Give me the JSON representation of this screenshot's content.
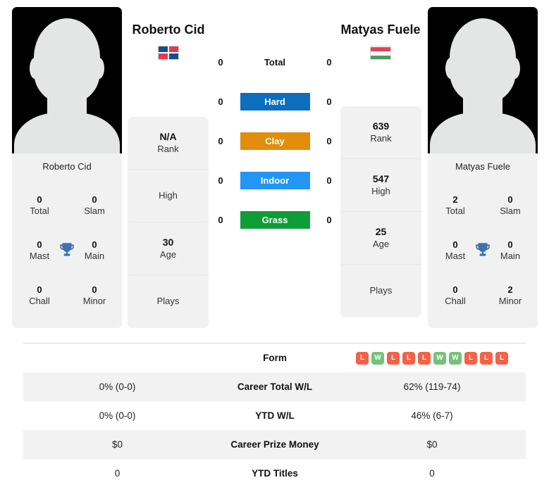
{
  "players": {
    "left": {
      "name": "Roberto Cid",
      "photo_caption": "Roberto Cid",
      "flag": "dominican-republic-flag",
      "rank": "N/A",
      "rank_label": "Rank",
      "high": "",
      "high_label": "High",
      "age": "30",
      "age_label": "Age",
      "plays": "",
      "plays_label": "Plays",
      "titles": [
        {
          "value": "0",
          "label": "Total"
        },
        {
          "value": "0",
          "label": "Slam"
        },
        {
          "value": "0",
          "label": "Mast"
        },
        {
          "value": "0",
          "label": "Main"
        },
        {
          "value": "0",
          "label": "Chall"
        },
        {
          "value": "0",
          "label": "Minor"
        }
      ]
    },
    "right": {
      "name": "Matyas Fuele",
      "photo_caption": "Matyas Fuele",
      "flag": "hungary-flag",
      "rank": "639",
      "rank_label": "Rank",
      "high": "547",
      "high_label": "High",
      "age": "25",
      "age_label": "Age",
      "plays": "",
      "plays_label": "Plays",
      "titles": [
        {
          "value": "2",
          "label": "Total"
        },
        {
          "value": "0",
          "label": "Slam"
        },
        {
          "value": "0",
          "label": "Mast"
        },
        {
          "value": "0",
          "label": "Main"
        },
        {
          "value": "0",
          "label": "Chall"
        },
        {
          "value": "2",
          "label": "Minor"
        }
      ]
    }
  },
  "surfaces": [
    {
      "label": "Total",
      "left": "0",
      "right": "0",
      "color": ""
    },
    {
      "label": "Hard",
      "left": "0",
      "right": "0",
      "color": "#0d6ebd"
    },
    {
      "label": "Clay",
      "left": "0",
      "right": "0",
      "color": "#e08e0b"
    },
    {
      "label": "Indoor",
      "left": "0",
      "right": "0",
      "color": "#2196f3"
    },
    {
      "label": "Grass",
      "left": "0",
      "right": "0",
      "color": "#0f9d37"
    }
  ],
  "stats_table": {
    "rows": [
      {
        "label": "Form",
        "left": "",
        "right": ""
      },
      {
        "label": "Career Total W/L",
        "left": "0% (0-0)",
        "right": "62% (119-74)"
      },
      {
        "label": "YTD W/L",
        "left": "0% (0-0)",
        "right": "46% (6-7)"
      },
      {
        "label": "Career Prize Money",
        "left": "$0",
        "right": "$0"
      },
      {
        "label": "YTD Titles",
        "left": "0",
        "right": "0"
      }
    ],
    "form_right": [
      "L",
      "W",
      "L",
      "L",
      "L",
      "W",
      "W",
      "L",
      "L",
      "L"
    ],
    "form_left": []
  },
  "colors": {
    "win_badge": "#74c27a",
    "loss_badge": "#f26247",
    "card_bg": "#f1f1f1",
    "trophy": "#4072b0"
  }
}
